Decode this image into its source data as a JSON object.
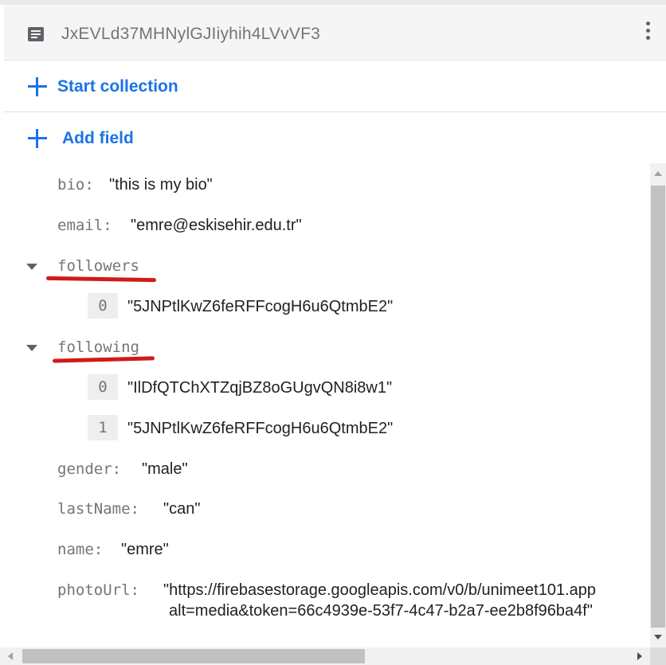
{
  "document": {
    "id": "JxEVLd37MHNylGJIiyhih4LVvVF3"
  },
  "actions": {
    "start_collection": "Start collection",
    "add_field": "Add field"
  },
  "fields": {
    "bio": {
      "key": "bio:",
      "value": "\"this is my bio\""
    },
    "email": {
      "key": "email:",
      "value": "\"emre@eskisehir.edu.tr\""
    },
    "followers": {
      "key": "followers",
      "items": [
        {
          "index": "0",
          "value": "\"5JNPtlKwZ6feRFFcogH6u6QtmbE2\""
        }
      ]
    },
    "following": {
      "key": "following",
      "items": [
        {
          "index": "0",
          "value": "\"IlDfQTChXTZqjBZ8oGUgvQN8i8w1\""
        },
        {
          "index": "1",
          "value": "\"5JNPtlKwZ6feRFFcogH6u6QtmbE2\""
        }
      ]
    },
    "gender": {
      "key": "gender:",
      "value": "\"male\""
    },
    "lastName": {
      "key": "lastName:",
      "value": "\"can\""
    },
    "name": {
      "key": "name:",
      "value": "\"emre\""
    },
    "photoUrl": {
      "key": "photoUrl:",
      "value_line1": "\"https://firebasestorage.googleapis.com/v0/b/unimeet101.app",
      "value_line2": "alt=media&token=66c4939e-53f7-4c47-b2a7-ee2b8f96ba4f\""
    }
  },
  "icons": {
    "document": "document-icon",
    "more": "more-vert-icon",
    "add": "plus-icon",
    "expand": "caret-down-icon"
  },
  "colors": {
    "accent": "#1a73e8",
    "annotation": "#d11a1a",
    "key_text": "#757575"
  }
}
